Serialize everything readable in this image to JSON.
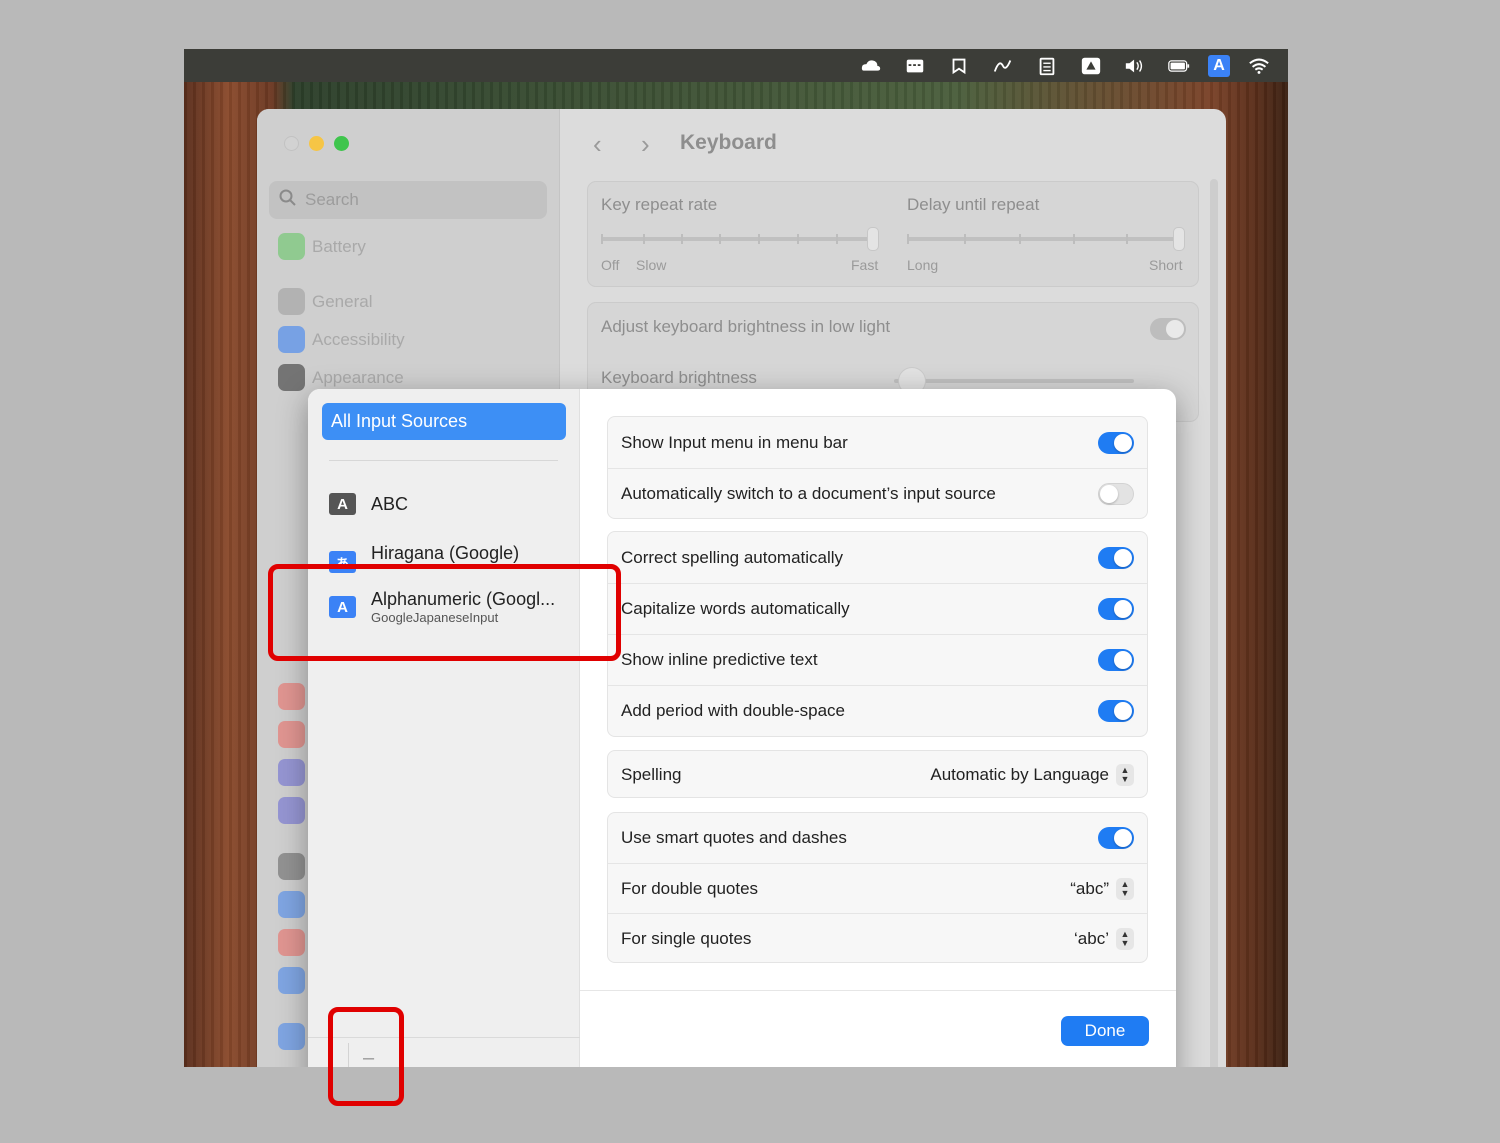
{
  "settings": {
    "title": "Keyboard",
    "search_placeholder": "Search",
    "sidebar": {
      "items": [
        {
          "label": "Battery",
          "color": "#5cc65c"
        },
        {
          "label": "General",
          "color": "#9b9b9b"
        },
        {
          "label": "Accessibility",
          "color": "#2f7bf6"
        },
        {
          "label": "Appearance",
          "color": "#2a2a2a"
        }
      ]
    },
    "key_repeat": {
      "label": "Key repeat rate",
      "min_label": "Off",
      "slow_label": "Slow",
      "max_label": "Fast"
    },
    "delay_repeat": {
      "label": "Delay until repeat",
      "min_label": "Long",
      "max_label": "Short"
    },
    "adjust_brightness_label": "Adjust keyboard brightness in low light",
    "keyboard_brightness_label": "Keyboard brightness"
  },
  "dialog": {
    "all_sources_label": "All Input Sources",
    "sources": [
      {
        "badge": "A",
        "name": "ABC",
        "badge_color": "#555555"
      },
      {
        "badge": "あ",
        "name": "Hiragana (Google)",
        "badge_color": "#3b82f6"
      },
      {
        "badge": "A",
        "name": "Alphanumeric (Googl...",
        "sub": "GoogleJapaneseInput",
        "badge_color": "#3b82f6"
      }
    ],
    "remove_label": "–",
    "group1": [
      {
        "label": "Show Input menu in menu bar",
        "on": true
      },
      {
        "label": "Automatically switch to a document’s input source",
        "on": false
      }
    ],
    "group2": [
      {
        "label": "Correct spelling automatically",
        "on": true
      },
      {
        "label": "Capitalize words automatically",
        "on": true
      },
      {
        "label": "Show inline predictive text",
        "on": true
      },
      {
        "label": "Add period with double-space",
        "on": true
      }
    ],
    "spelling": {
      "label": "Spelling",
      "value": "Automatic by Language"
    },
    "group4": {
      "smart_quotes": {
        "label": "Use smart quotes and dashes",
        "on": true
      },
      "double_quotes": {
        "label": "For double quotes",
        "value": "“abc”"
      },
      "single_quotes": {
        "label": "For single quotes",
        "value": "‘abc’"
      }
    },
    "done_label": "Done"
  },
  "menubar": {
    "ime_indicator": "A"
  },
  "colors": {
    "accent": "#1f7cf3",
    "highlight": "#e00000"
  }
}
